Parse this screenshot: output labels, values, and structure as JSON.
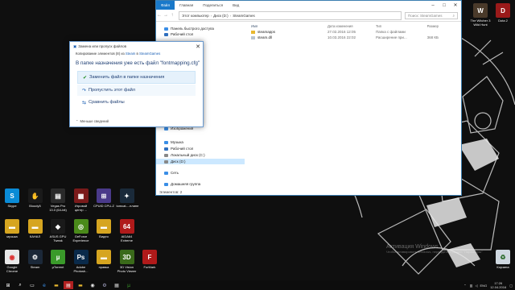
{
  "explorer": {
    "tabs": [
      "Файл",
      "Главная",
      "Поделиться",
      "Вид"
    ],
    "address": [
      "Этот компьютер",
      "Диск (D:)",
      "SteamGames"
    ],
    "search_placeholder": "Поиск: SteamGames",
    "nav_items": [
      {
        "label": "Панель быстрого доступа",
        "icon": "star-icon",
        "color": "#3a8ee6"
      },
      {
        "label": "Рабочий стол",
        "icon": "desktop-icon",
        "color": "#2f6fbf"
      },
      {
        "label": "Изображения",
        "icon": "pictures-icon",
        "color": "#3a8ee6"
      },
      {
        "label": "Музыка",
        "icon": "music-icon",
        "color": "#3a8ee6"
      },
      {
        "label": "Рабочий стол",
        "icon": "desktop-icon",
        "color": "#2f6fbf"
      },
      {
        "label": "Локальный диск (C:)",
        "icon": "drive-icon",
        "color": "#888888"
      },
      {
        "label": "Диск (D:)",
        "icon": "drive-icon",
        "color": "#888888",
        "selected": true
      },
      {
        "label": "Сеть",
        "icon": "network-icon",
        "color": "#3a8ee6"
      },
      {
        "label": "Домашняя группа",
        "icon": "homegroup-icon",
        "color": "#3a8ee6"
      }
    ],
    "columns": [
      "Имя",
      "Дата изменения",
      "Тип",
      "Размер"
    ],
    "files": [
      {
        "name": "steamapps",
        "date": "27.02.2016 12:05",
        "type": "Папка с файлами",
        "size": "",
        "icon": "folder-icon"
      },
      {
        "name": "steam.dll",
        "date": "10.03.2016 22:02",
        "type": "Расширение при...",
        "size": "368 КБ",
        "icon": "dll-icon"
      }
    ],
    "status": "Элементов: 2"
  },
  "dialog": {
    "title": "Замена или пропуск файлов",
    "copy_prefix": "Копирование элементов (8) из",
    "source": "Steam",
    "copy_mid": "в",
    "dest": "SteamGames",
    "headline": "В папке назначения уже есть файл \"fontmapping.cfg\"",
    "options": [
      "Заменить файл в папке назначения",
      "Пропустить этот файл",
      "Сравнить файлы"
    ],
    "less_details": "Меньше сведений"
  },
  "desktop_icons": [
    {
      "label": "Skype",
      "color": "#0a8bd6",
      "glyph": "S"
    },
    {
      "label": "Bloody5",
      "color": "#1a1a1a",
      "glyph": "✋"
    },
    {
      "label": "Vegas Pro 13.0 (64-bit)",
      "color": "#2a2a2a",
      "glyph": "▤"
    },
    {
      "label": "Игровой центр ...",
      "color": "#7a1a1a",
      "glyph": "▦"
    },
    {
      "label": "CPUID CPU-Z",
      "color": "#4a3a8a",
      "glyph": "⊞"
    },
    {
      "label": "tomcat-...нлине",
      "color": "#1a2a3a",
      "glyph": "✦"
    },
    {
      "label": "музыка",
      "color": "#d6a520",
      "glyph": "▬"
    },
    {
      "label": "КАНАЛ",
      "color": "#d6a520",
      "glyph": "▬"
    },
    {
      "label": "ASUS GPU Tweak",
      "color": "#1a1a1a",
      "glyph": "◆"
    },
    {
      "label": "GeForce Experience",
      "color": "#4a8a1a",
      "glyph": "◎"
    },
    {
      "label": "Видео",
      "color": "#d6a520",
      "glyph": "▬"
    },
    {
      "label": "AIDA64 Extreme",
      "color": "#b01a1a",
      "glyph": "64"
    },
    {
      "label": "Google Chrome",
      "color": "#e8e8e8",
      "glyph": "◉"
    },
    {
      "label": "Steam",
      "color": "#1b2838",
      "glyph": "⚙"
    },
    {
      "label": "µTorrent",
      "color": "#3a9a2a",
      "glyph": "µ"
    },
    {
      "label": "Adobe Photosh...",
      "color": "#0a2a4a",
      "glyph": "Ps"
    },
    {
      "label": "правка",
      "color": "#d6a520",
      "glyph": "▬"
    },
    {
      "label": "3D Vision Photo Viewer",
      "color": "#3a6a1a",
      "glyph": "3D"
    },
    {
      "label": "FurMark",
      "color": "#b01a1a",
      "glyph": "F"
    }
  ],
  "right_icons": [
    {
      "label": "The Witcher 3 Wild Hunt",
      "color": "#4a3a2a",
      "glyph": "W"
    },
    {
      "label": "Dota 2",
      "color": "#9a1a1a",
      "glyph": "D"
    },
    {
      "label": "Корзина",
      "color": "#cfd8e0",
      "glyph": "♻"
    }
  ],
  "watermark": [
    "Активация Windows",
    "Чтобы активировать Windows, перейдите в раздел \"Параметры\""
  ],
  "taskbar": {
    "lang": "ENG",
    "time": "17:26",
    "date": "12.04.2016"
  }
}
